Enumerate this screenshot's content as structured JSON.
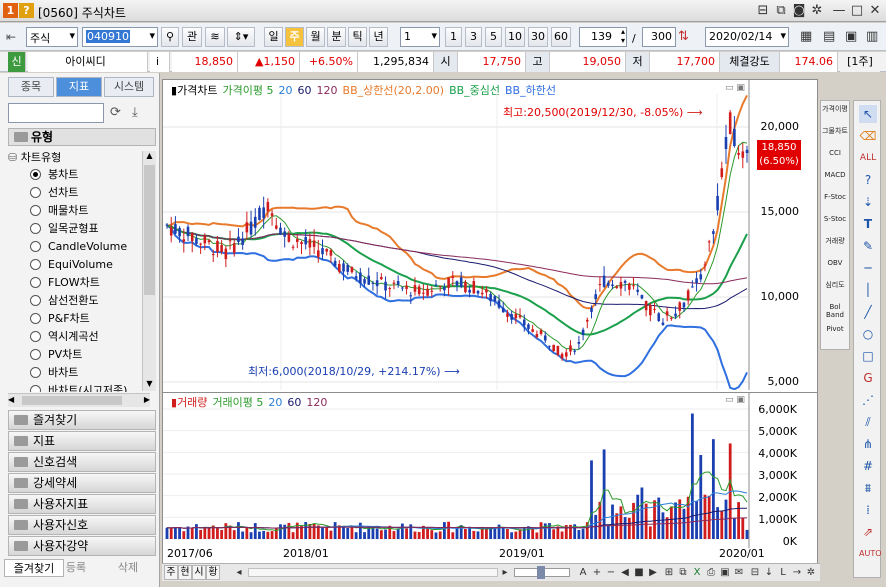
{
  "window": {
    "screen_no": "[0560]",
    "title": "주식차트",
    "help_icon": "?",
    "screen_icon": "1"
  },
  "toolbar": {
    "market": "주식",
    "code": "040910",
    "watch_label": "관",
    "periods": [
      "일",
      "주",
      "월",
      "분",
      "틱",
      "년"
    ],
    "active_period": "주",
    "interval_select": "1",
    "intervals": [
      "1",
      "3",
      "5",
      "10",
      "30",
      "60"
    ],
    "count_value": "139",
    "count_sep": "/",
    "total_count": "300",
    "date": "2020/02/14"
  },
  "quote": {
    "badge": "신",
    "name": "아이씨디",
    "info": "i",
    "price": "18,850",
    "change": "▲1,150",
    "change_pct": "+6.50%",
    "volume": "1,295,834",
    "open_label": "시",
    "open": "17,750",
    "high_label": "고",
    "high": "19,050",
    "low_label": "저",
    "low": "17,700",
    "strength_label": "체결강도",
    "strength": "174.06",
    "unit": "[1주]"
  },
  "left_panel": {
    "tabs": [
      "종목",
      "지표",
      "시스템"
    ],
    "active_tab": "지표",
    "search_value": "",
    "type_header": "유형",
    "chart_type_group": "차트유형",
    "chart_types": [
      "봉차트",
      "선차트",
      "매물차트",
      "일목균형표",
      "CandleVolume",
      "EquiVolume",
      "FLOW차트",
      "삼선전환도",
      "P&F차트",
      "역시계곡선",
      "PV차트",
      "바차트",
      "바차트(시고저종)"
    ],
    "selected_type": "봉차트",
    "sections": [
      "즐겨찾기",
      "지표",
      "신호검색",
      "강세약세",
      "사용자지표",
      "사용자신호",
      "사용자강약"
    ],
    "bottom_tabs": [
      "즐겨찾기",
      "등록",
      "삭제"
    ]
  },
  "price_pane": {
    "legend": [
      {
        "label": "가격차트",
        "color": "#000000"
      },
      {
        "label": "가격이평 5",
        "color": "#2a9a2a"
      },
      {
        "label": "20",
        "color": "#2a7fd6"
      },
      {
        "label": "60",
        "color": "#1a1a6e"
      },
      {
        "label": "120",
        "color": "#8b2a5a"
      },
      {
        "label": "BB_상한선(20,2.00)",
        "color": "#e77a2b"
      },
      {
        "label": "BB_중심선",
        "color": "#1aa04b"
      },
      {
        "label": "BB_하한선",
        "color": "#2f6fe0"
      }
    ],
    "high_note": "최고:20,500(2019/12/30, -8.05%)",
    "low_note": "최저:6,000(2018/10/29, +214.17%)",
    "y_ticks": [
      "20,000",
      "15,000",
      "10,000",
      "5,000"
    ],
    "current_price": "18,850",
    "current_pct": "(6.50%)"
  },
  "volume_pane": {
    "legend": [
      {
        "label": "거래량",
        "color": "#d01c1c"
      },
      {
        "label": "거래이평 5",
        "color": "#2a9a2a"
      },
      {
        "label": "20",
        "color": "#2a7fd6"
      },
      {
        "label": "60",
        "color": "#1a1a6e"
      },
      {
        "label": "120",
        "color": "#8b2a5a"
      }
    ],
    "y_ticks": [
      "6,000K",
      "5,000K",
      "4,000K",
      "3,000K",
      "2,000K",
      "1,000K",
      "0K"
    ]
  },
  "x_ticks": [
    "2017/06",
    "2018/01",
    "2019/01",
    "2020/01"
  ],
  "indicator_bar": [
    "가격이평",
    "그물차트",
    "CCI",
    "MACD",
    "F-Stoc",
    "S-Stoc",
    "거래량",
    "OBV",
    "심리도",
    "Bol Band",
    "Pivot"
  ],
  "bottom_strip": {
    "tabs": [
      "주",
      "현",
      "시",
      "황"
    ]
  },
  "colors": {
    "up": "#d01c1c",
    "down": "#1a3fb0",
    "bb_upper": "#e77a2b",
    "bb_mid": "#1aa04b",
    "bb_lower": "#2f6fe0",
    "accent": "#f6c23e"
  }
}
